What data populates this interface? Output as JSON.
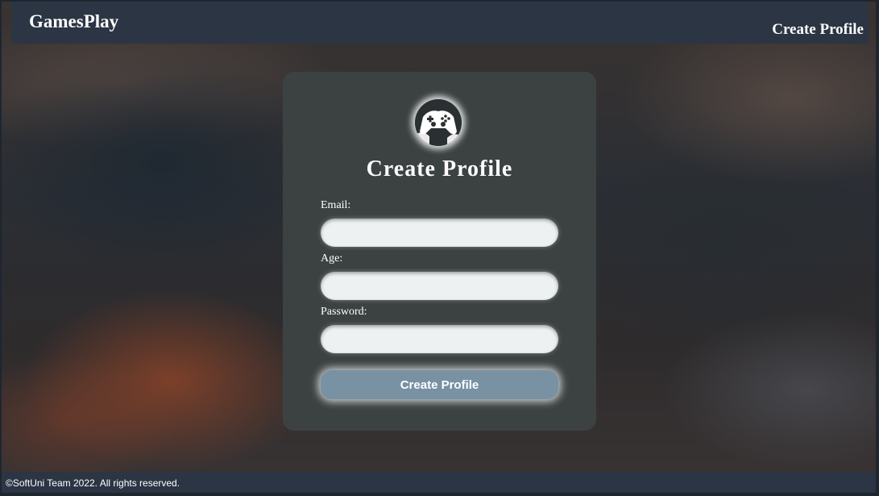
{
  "header": {
    "logo": "GamesPlay",
    "nav_link": "Create Profile"
  },
  "form": {
    "title": "Create Profile",
    "badge_icon": "gamepad-icon",
    "fields": [
      {
        "label": "Email:",
        "value": "",
        "placeholder": ""
      },
      {
        "label": "Age:",
        "value": "",
        "placeholder": ""
      },
      {
        "label": "Password:",
        "value": "",
        "placeholder": ""
      }
    ],
    "submit_label": "Create Profile"
  },
  "footer": {
    "text": "©SoftUni Team 2022. All rights reserved."
  },
  "colors": {
    "header_bg": "#2b3544",
    "card_bg": "#3c4242",
    "button_bg": "#7891a3"
  }
}
